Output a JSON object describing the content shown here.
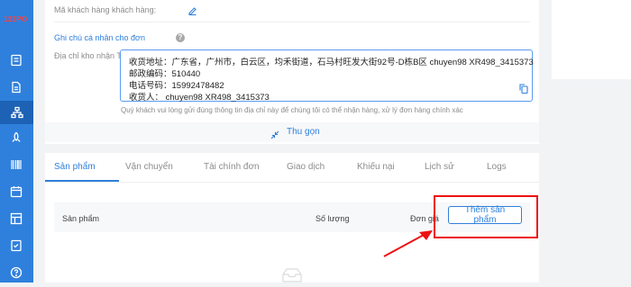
{
  "app": {
    "logo_text": "123PO"
  },
  "sidebar": {
    "items": [
      {
        "icon": "list-icon"
      },
      {
        "icon": "document-icon"
      },
      {
        "icon": "network-icon",
        "active": true
      },
      {
        "icon": "rocket-icon"
      },
      {
        "icon": "barcode-icon"
      },
      {
        "icon": "calendar-icon"
      },
      {
        "icon": "grid-icon"
      },
      {
        "icon": "checklist-icon"
      },
      {
        "icon": "help-icon"
      }
    ]
  },
  "order_info": {
    "customer_code_label": "Mã khách hàng khách hàng:",
    "private_note_link": "Ghi chú cá nhân cho đơn",
    "warehouse_address_label": "Địa chỉ kho nhận TQ:",
    "address_lines": [
      "收货地址：广东省，广州市，白云区，均禾街道，石马村旺发大街92号-D栋B区 chuyen98 XR498_3415373",
      "邮政编码：510440",
      "电话号码：15992478482",
      "收货人： chuyen98 XR498_3415373"
    ],
    "address_hint": "Quý khách vui lòng gửi đúng thông tin địa chỉ này để chúng tôi có thể nhận hàng, xử lý đơn hàng chính xác",
    "collapse_label": "Thu gọn"
  },
  "tabs": [
    {
      "label": "Sản phẩm",
      "active": true
    },
    {
      "label": "Vận chuyển"
    },
    {
      "label": "Tài chính đơn"
    },
    {
      "label": "Giao dịch"
    },
    {
      "label": "Khiếu nại"
    },
    {
      "label": "Lịch sử"
    },
    {
      "label": "Logs"
    }
  ],
  "product_table": {
    "columns": [
      "Sản phẩm",
      "Số lượng",
      "Đơn giá"
    ],
    "add_button_label": "Thêm sản phẩm"
  },
  "colors": {
    "accent": "#2f80dc",
    "sidebar": "#2f80dc",
    "annotation": "#e11111"
  }
}
